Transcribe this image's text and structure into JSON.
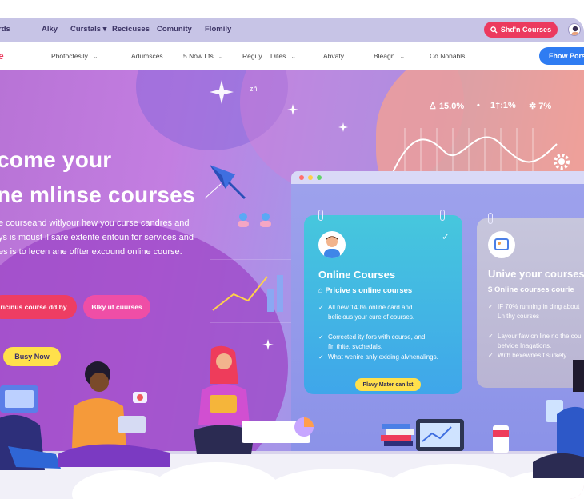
{
  "topnav": {
    "items": [
      "rds",
      "Alky",
      "Curstals",
      "Recicuses",
      "Comunity",
      "Flomily"
    ],
    "curstals_chevron": "▾",
    "cta_label": "Shd'n Courses",
    "cta_icon": "search-icon"
  },
  "subnav": {
    "logo": "e",
    "items": [
      "Photoctesily",
      "Adumsces",
      "5 Now Lts",
      "Reguy",
      "Dites",
      "Abvaty",
      "Bleagn",
      "Co Nonabls"
    ],
    "chevron": "⌄",
    "button_label": "Fhow Porsca"
  },
  "hero": {
    "title_line1": "come your",
    "title_line2": "ne mlinse courses",
    "desc_lines": [
      "e courseand witlyour hew you curse candres and",
      "ys is moust il sare extente entoun for services and",
      "es is to lecen ane offter excound online course."
    ],
    "btn_primary": "ricinus course dd by",
    "btn_secondary": "Blky ut cuurses",
    "busy_label": "Busy Now",
    "stats": [
      "15.0%",
      "1†:1%",
      "7%"
    ],
    "small_label": "zñ"
  },
  "card1": {
    "title": "Online Courses",
    "subtitle": "Pricive s online courses",
    "bullets": [
      [
        "All new 140% online card and",
        "belicious your cure of courses."
      ],
      [
        "Corrected ity fors with course, and",
        "fin thite, svchedals."
      ],
      [
        "What wenire anly exiding alvhenalings."
      ]
    ],
    "button_label": "Plavy Mater can lxt"
  },
  "card2": {
    "title": "Unive your courses",
    "subtitle": "Online courses courie",
    "bullets": [
      [
        "IF 70% running in ding about",
        "Ln thy courses"
      ],
      [
        "Layour faw on line no the cou",
        "betvide Inagations."
      ],
      [
        "With bexewnes t surkely"
      ]
    ]
  },
  "colors": {
    "accent_red": "#ec3a5e",
    "accent_pink": "#ef4ea6",
    "accent_blue": "#2f7cf2",
    "accent_yellow": "#ffe04b"
  }
}
